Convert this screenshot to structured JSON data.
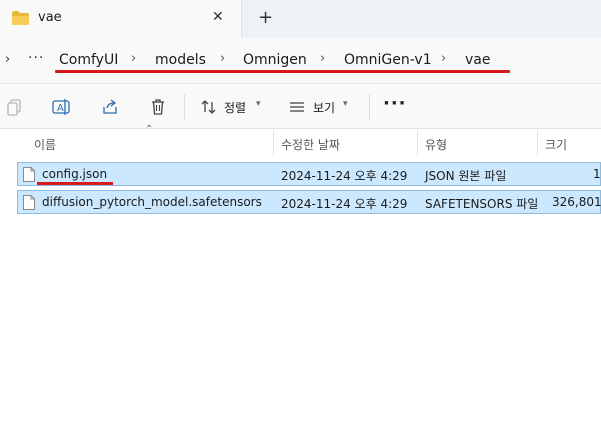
{
  "tab": {
    "title": "vae",
    "close": "✕",
    "new_tab": "+"
  },
  "breadcrumb": {
    "nav_arrow": "›",
    "more": "···",
    "items": [
      "ComfyUI",
      "models",
      "Omnigen",
      "OmniGen-v1",
      "vae"
    ],
    "separator": "›"
  },
  "commandbar": {
    "sort_label": "정렬",
    "view_label": "보기",
    "more": "···"
  },
  "columns": {
    "name": "이름",
    "modified": "수정한 날짜",
    "type": "유형",
    "size": "크기"
  },
  "files": [
    {
      "name": "config.json",
      "modified": "2024-11-24 오후 4:29",
      "type": "JSON 원본 파일",
      "size": "1"
    },
    {
      "name": "diffusion_pytorch_model.safetensors",
      "modified": "2024-11-24 오후 4:29",
      "type": "SAFETENSORS 파일",
      "size": "326,801"
    }
  ],
  "colors": {
    "selection": "#cce8ff",
    "annotation_red": "#d7181c",
    "folder": "#f4c542"
  }
}
